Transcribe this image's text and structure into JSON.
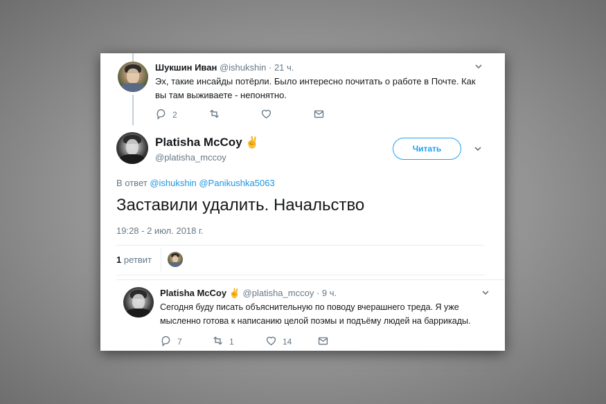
{
  "tweet_prev": {
    "name": "Шукшин Иван",
    "handle": "@ishukshin",
    "time": "· 21 ч.",
    "text_line1": "Эх, такие инсайды потёрли. Было интересно почитать о работе в Почте. Как",
    "text_line2": "вы там выживаете - непонятно.",
    "replies": "2"
  },
  "main_tweet": {
    "name": "Platisha McCoy",
    "handle": "@platisha_mccoy",
    "follow_label": "Читать",
    "reply_prefix": "В ответ",
    "reply_to_1": "@ishukshin",
    "reply_to_2": "@Panikushka5063",
    "text": "Заставили удалить. Начальство",
    "timestamp": "19:28 - 2 июл. 2018 г.",
    "retweet_count": "1",
    "retweet_label": "ретвит"
  },
  "reply_tweet": {
    "name": "Platisha McCoy",
    "handle": "@platisha_mccoy",
    "time": "· 9 ч.",
    "text_line1": "Сегодня буду писать объяснительную по поводу вчерашнего треда. Я уже",
    "text_line2": "мысленно готова к написанию целой поэмы и подъёму людей на баррикады.",
    "replies": "7",
    "retweets": "1",
    "likes": "14"
  },
  "colors": {
    "accent": "#1da1f2",
    "link": "#1b95e0",
    "muted": "#657786"
  },
  "icons": [
    "reply-icon",
    "retweet-icon",
    "like-icon",
    "message-icon",
    "chevron-down-icon",
    "hand-emoji-icon"
  ]
}
